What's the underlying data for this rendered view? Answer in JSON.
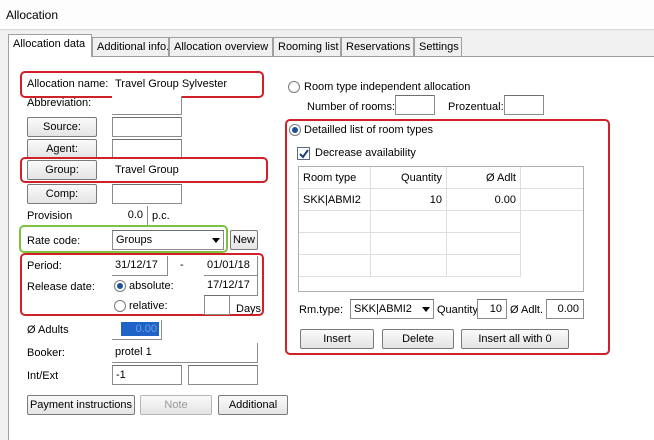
{
  "window": {
    "title": "Allocation"
  },
  "tabs": [
    "Allocation data",
    "Additional info.",
    "Allocation overview",
    "Rooming list",
    "Reservations",
    "Settings"
  ],
  "left": {
    "allocation_name_label": "Allocation name:",
    "allocation_name_value": "Travel Group Sylvester",
    "abbreviation_label": "Abbreviation:",
    "source_button": "Source:",
    "agent_button": "Agent:",
    "group_button": "Group:",
    "group_value": "Travel Group",
    "comp_button": "Comp:",
    "provision_label": "Provision",
    "provision_value": "0.0",
    "provision_unit": "p.c.",
    "rate_code_label": "Rate code:",
    "rate_code_value": "Groups",
    "new_button": "New",
    "period_label": "Period:",
    "period_from": "31/12/17",
    "period_sep": "-",
    "period_to": "01/01/18",
    "release_label": "Release date:",
    "absolute_label": "absolute:",
    "absolute_value": "17/12/17",
    "relative_label": "relative:",
    "days_label": "Days",
    "adults_label": "Ø Adults",
    "adults_value": "0.00",
    "booker_label": "Booker:",
    "booker_value": "protel 1",
    "intext_label": "Int/Ext",
    "intext_value": "-1",
    "payment_button": "Payment instructions",
    "note_button": "Note",
    "additional_button": "Additional"
  },
  "right": {
    "independent_label": "Room type independent allocation",
    "rooms_label": "Number of rooms:",
    "percent_label": "Prozentual:",
    "detailed_label": "Detailled list of room types",
    "decrease_label": "Decrease availability",
    "grid": {
      "columns": [
        "Room type",
        "Quantity",
        "Ø Adlt"
      ],
      "rows": [
        {
          "room_type": "SKK|ABMI2",
          "quantity": "10",
          "adlt": "0.00"
        }
      ]
    },
    "rmtype_label": "Rm.type:",
    "rmtype_value": "SKK|ABMI2",
    "quantity_label": "Quantity",
    "quantity_value": "10",
    "adlt_label": "Ø Adlt.",
    "adlt_value": "0.00",
    "insert_button": "Insert",
    "delete_button": "Delete",
    "insert_all_button": "Insert all with 0"
  },
  "colors": {
    "highlight_red": "#d0202a",
    "highlight_green": "#7ec242",
    "selection": "#1f63c6"
  }
}
